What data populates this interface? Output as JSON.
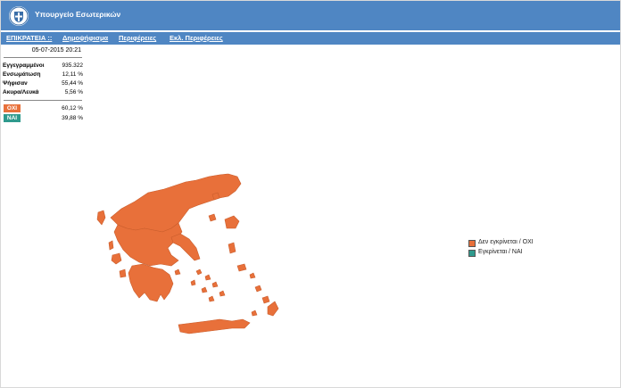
{
  "header": {
    "title": "Υπουργείο Εσωτερικών",
    "logo_icon": "greek-coat-of-arms-icon"
  },
  "nav": {
    "items": [
      {
        "label": "ΕΠΙΚΡΑΤΕΙΑ ::"
      },
      {
        "label": "Δημοψήφισμα"
      },
      {
        "label": "Περιφέρειες"
      },
      {
        "label": "Εκλ. Περιφέρειες"
      }
    ]
  },
  "summary": {
    "timestamp": "05-07-2015 20:21",
    "stats": [
      {
        "label": "Εγγεγραμμένοι",
        "value": "935.322"
      },
      {
        "label": "Ενσωμάτωση",
        "value": "12,11 %"
      },
      {
        "label": "Ψήφισαν",
        "value": "55,44 %"
      },
      {
        "label": "Ακυρα/Λευκά",
        "value": "5,56 %"
      }
    ],
    "results": [
      {
        "label": "ΟΧΙ",
        "value": "60,12 %",
        "color": "#e8703a"
      },
      {
        "label": "ΝΑΙ",
        "value": "39,88 %",
        "color": "#2f9a8d"
      }
    ]
  },
  "legend": [
    {
      "label": "Δεν εγκρίνεται / ΟΧΙ",
      "color": "#e8703a"
    },
    {
      "label": "Εγκρίνεται / ΝΑΙ",
      "color": "#2f9a8d"
    }
  ],
  "map": {
    "fill_color": "#e8703a",
    "icon": "greece-map"
  }
}
